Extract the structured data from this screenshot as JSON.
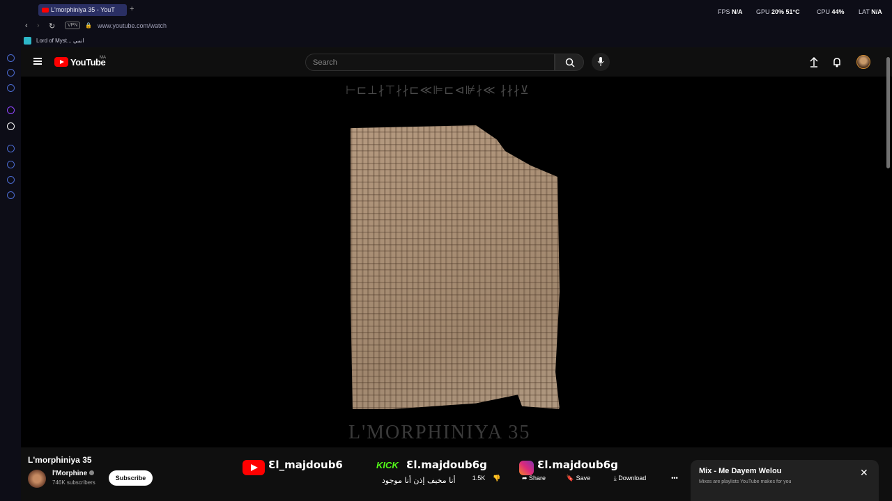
{
  "browser": {
    "tab_title": "L'morphiniya 35 - YouT",
    "new_tab": "+",
    "url": "www.youtube.com/watch",
    "vpn": "VPN",
    "bookmark": "Lord of Myst... انمي",
    "stats": {
      "fps_label": "FPS",
      "fps_value": "N/A",
      "gpu_label": "GPU",
      "gpu_value": "20% 51°C",
      "cpu_label": "CPU",
      "cpu_value": "44%",
      "lat_label": "LAT",
      "lat_value": "N/A"
    }
  },
  "youtube": {
    "logo_text": "YouTube",
    "logo_region": "MA",
    "search_placeholder": "Search"
  },
  "player": {
    "glyphs": "⊢⊏⊥∤⊤∤∤⊏≪⊫⊏⊲⊯∤≪  ∤∤∤⊻",
    "title_overlay": "L'MORPHINIYA 35"
  },
  "video": {
    "title": "L'morphiniya 35",
    "channel": "l'Morphine",
    "subscribers": "746K subscribers",
    "subscribe": "Subscribe",
    "likes": "1.5K",
    "share": "Share",
    "save": "Save",
    "download": "Download",
    "more": "•••"
  },
  "overlay": {
    "youtube_handle": "Ɛl_majdoub6",
    "kick_label": "KICK",
    "kick_handle": "Ɛl.majdoub6g",
    "instagram_handle": "Ɛl.majdoub6g",
    "arabic_caption": "أنا مخيف إذن أنا موجود"
  },
  "mix": {
    "title": "Mix - Me Dayem Welou",
    "subtitle": "Mixes are playlists YouTube makes for you",
    "close": "✕"
  }
}
